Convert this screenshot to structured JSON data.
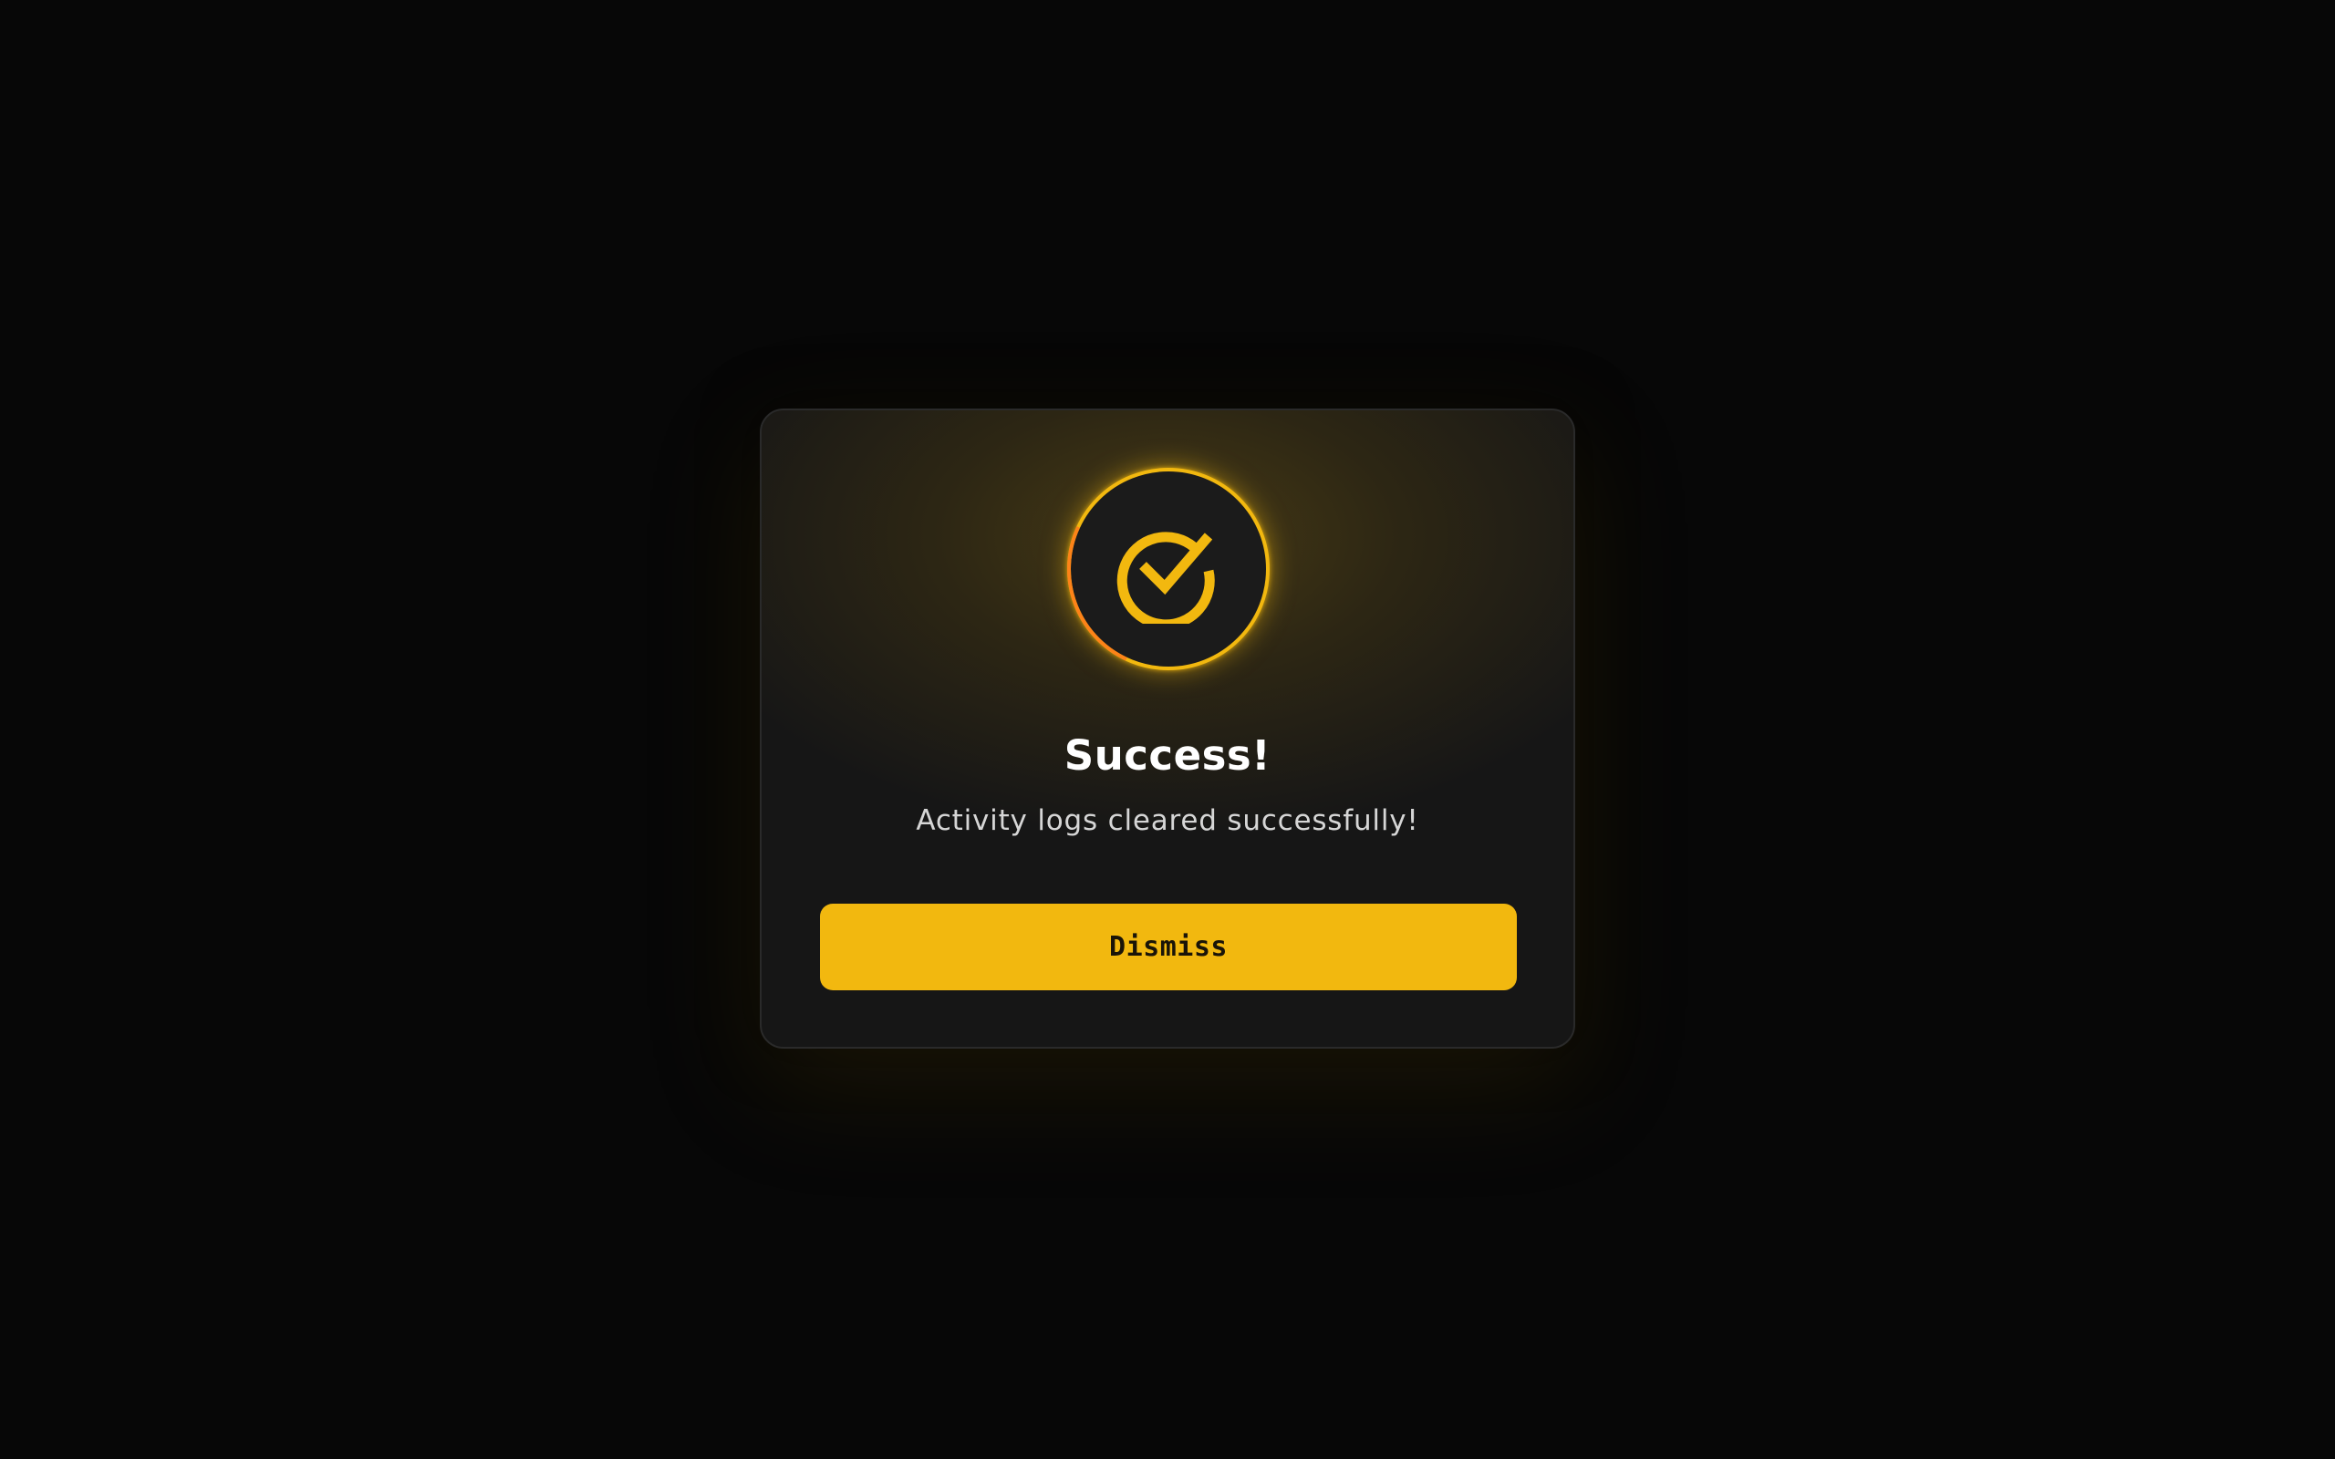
{
  "dialog": {
    "icon": "check-circle-icon",
    "title": "Success!",
    "message": "Activity logs cleared successfully!",
    "dismiss_label": "Dismiss"
  },
  "colors": {
    "accent": "#f2b80f",
    "accent_edge": "#ff7a1a",
    "modal_bg": "#161616",
    "page_bg": "#070707",
    "title_text": "#ffffff",
    "message_text": "#d6d6d6",
    "button_text": "#1a1408"
  }
}
